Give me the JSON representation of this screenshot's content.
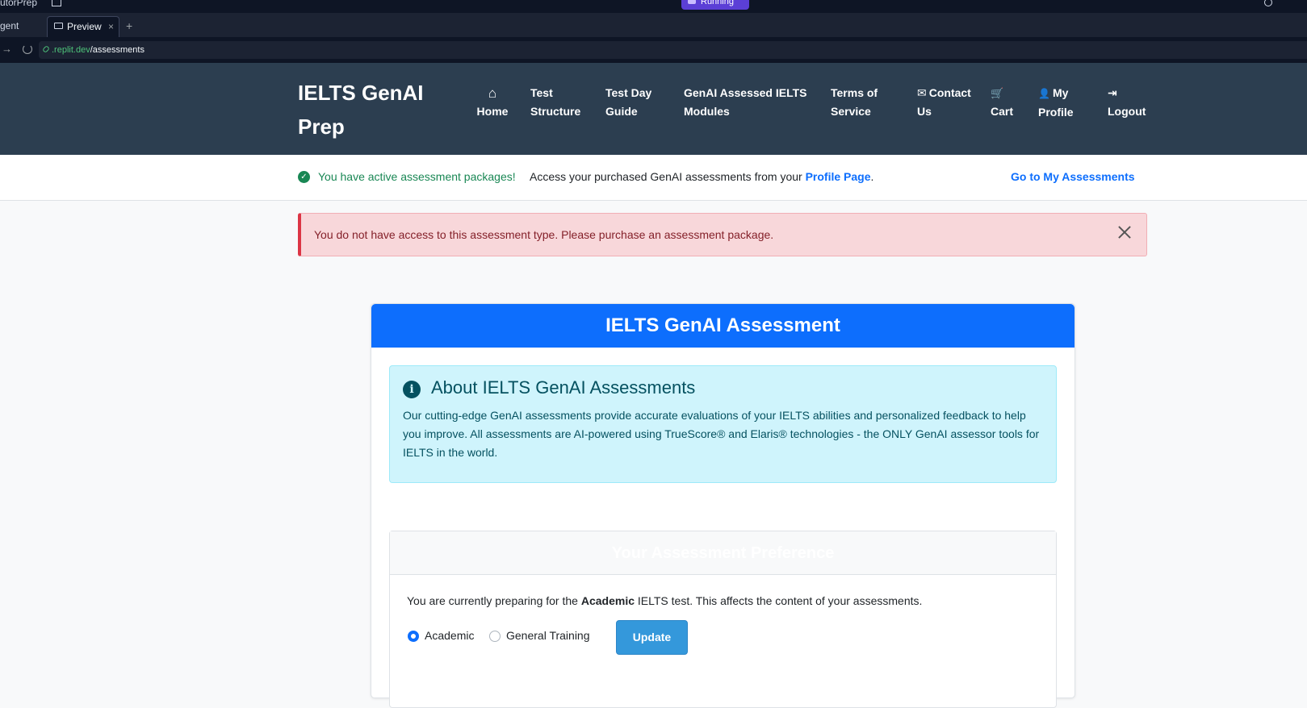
{
  "browser": {
    "window_title_fragment": "utorPrep",
    "running_label": "Running",
    "tabs": [
      {
        "label": "gent"
      },
      {
        "label": "Preview"
      }
    ],
    "tab_close": "×",
    "tab_add": "+",
    "nav_arrow": "→",
    "url_domain": ".replit.dev",
    "url_path": "/assessments"
  },
  "navbar": {
    "brand": "IELTS GenAI Prep",
    "items": [
      {
        "id": "home",
        "icon": "home-icon",
        "glyph": "⌂",
        "label": "Home"
      },
      {
        "id": "test-structure",
        "label": "Test Structure"
      },
      {
        "id": "test-day-guide",
        "label": "Test Day Guide"
      },
      {
        "id": "genai-modules",
        "label": "GenAI Assessed IELTS Modules"
      },
      {
        "id": "terms",
        "label": "Terms of Service"
      },
      {
        "id": "contact",
        "icon": "envelope-icon",
        "glyph": "✉",
        "label": "Contact Us"
      },
      {
        "id": "cart",
        "icon": "cart-icon",
        "glyph": "🛒",
        "label": "Cart"
      },
      {
        "id": "profile",
        "icon": "user-icon",
        "glyph": "👤",
        "label": "My Profile"
      },
      {
        "id": "logout",
        "icon": "logout-icon",
        "glyph": "⇥",
        "label": "Logout"
      }
    ]
  },
  "packages": {
    "active_text": "You have active assessment packages!",
    "access_text": "Access your purchased GenAI assessments from your",
    "profile_link": "Profile Page",
    "period": ".",
    "goto_link": "Go to My Assessments"
  },
  "alert": {
    "message": "You do not have access to this assessment type. Please purchase an assessment package."
  },
  "card": {
    "title": "IELTS GenAI Assessment",
    "info": {
      "heading": "About IELTS GenAI Assessments",
      "body": "Our cutting-edge GenAI assessments provide accurate evaluations of your IELTS abilities and personalized feedback to help you improve. All assessments are AI-powered using TrueScore® and Elaris® technologies - the ONLY GenAI assessor tools for IELTS in the world."
    },
    "preference": {
      "title": "Your Assessment Preference",
      "line_prefix": "You are currently preparing for the",
      "line_bold": "Academic",
      "line_suffix": "IELTS test. This affects the content of your assessments.",
      "options": [
        {
          "label": "Academic",
          "checked": true
        },
        {
          "label": "General Training",
          "checked": false
        }
      ],
      "update_label": "Update"
    }
  },
  "colors": {
    "navbar_bg": "#2c3e50",
    "primary": "#0d6efd",
    "success": "#198754",
    "danger_border": "#dc3545",
    "info_bg": "#cff4fc",
    "update_btn": "#3498db"
  }
}
